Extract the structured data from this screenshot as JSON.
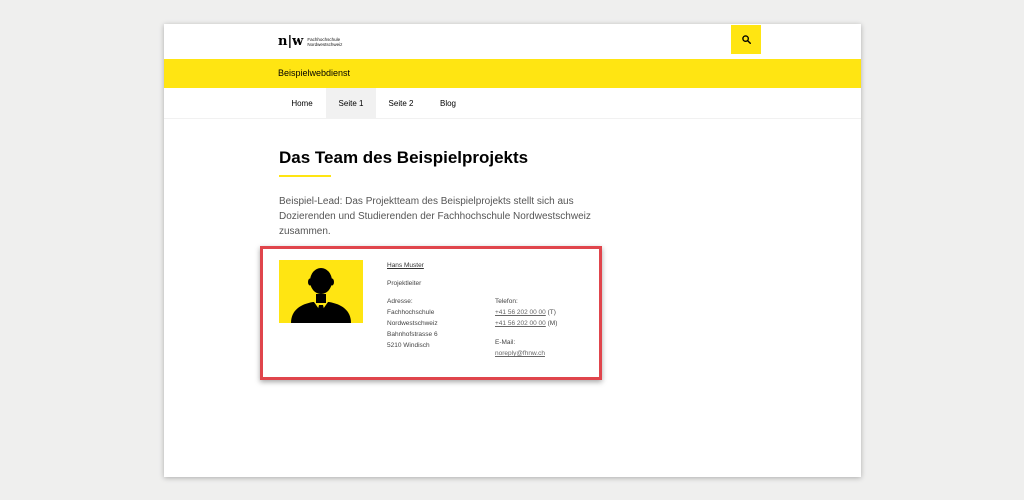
{
  "header": {
    "logo_mark": "n|w",
    "logo_line1": "Fachhochschule",
    "logo_line2": "Nordwestschweiz",
    "search_icon": "search-icon"
  },
  "site": {
    "name": "Beispielwebdienst"
  },
  "nav": {
    "items": [
      {
        "label": "Home"
      },
      {
        "label": "Seite 1"
      },
      {
        "label": "Seite 2"
      },
      {
        "label": "Blog"
      }
    ],
    "active": "Seite 1"
  },
  "main": {
    "title": "Das Team des Beispielprojekts",
    "lead": "Beispiel-Lead: Das Projektteam des Beispielprojekts stellt sich aus Dozierenden und Studierenden der Fachhochschule Nordwestschweiz zusammen."
  },
  "person": {
    "avatar_icon": "person-silhouette-icon",
    "name": "Hans Muster",
    "role": "Projektleiter",
    "address": {
      "label": "Adresse:",
      "line1": "Fachhochschule",
      "line2": "Nordwestschweiz",
      "line3": "Bahnhofstrasse 6",
      "line4": "5210 Windisch"
    },
    "phone": {
      "label": "Telefon:",
      "number1": "+41 56 202 00 00",
      "type1": "(T)",
      "number2": "+41 56 202 00 00",
      "type2": "(M)"
    },
    "email": {
      "label": "E-Mail:",
      "address": "noreply@fhnw.ch"
    }
  },
  "colors": {
    "brand_yellow": "#ffe512",
    "highlight_red": "#e0454c",
    "background": "#efefee"
  }
}
